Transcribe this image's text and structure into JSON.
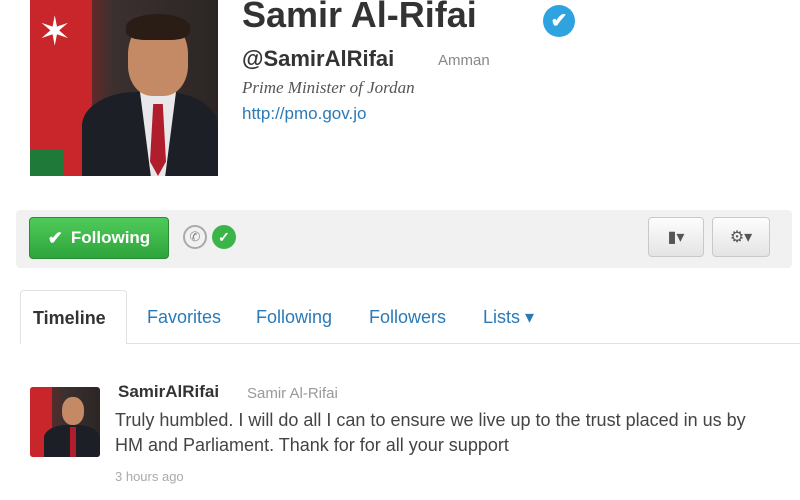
{
  "profile": {
    "name": "Samir Al-Rifai",
    "handle": "@SamirAlRifai",
    "location": "Amman",
    "bio": "Prime Minister of Jordan",
    "url": "http://pmo.gov.jo",
    "verified_glyph": "✔"
  },
  "actions": {
    "follow_label": "Following",
    "follow_check": "✔",
    "notify_glyph": "✆",
    "active_glyph": "✓",
    "message_glyph": "▮▾",
    "gear_glyph": "⚙▾"
  },
  "tabs": [
    {
      "label": "Timeline",
      "active": true
    },
    {
      "label": "Favorites",
      "active": false
    },
    {
      "label": "Following",
      "active": false
    },
    {
      "label": "Followers",
      "active": false
    },
    {
      "label": "Lists ▾",
      "active": false
    }
  ],
  "tweet": {
    "username": "SamirAlRifai",
    "fullname": "Samir Al-Rifai",
    "text": "Truly humbled. I will do all I can to ensure we live up to the trust placed in us by HM and Parliament. Thank for for all your support",
    "time": "3 hours ago"
  },
  "colors": {
    "follow_green": "#3bb44a",
    "link_blue": "#2a7ab8",
    "verified_blue": "#2fa3e0"
  },
  "icons": [
    "verified-badge-icon",
    "check-icon",
    "notification-icon",
    "message-icon",
    "gear-icon",
    "chevron-down-icon"
  ]
}
